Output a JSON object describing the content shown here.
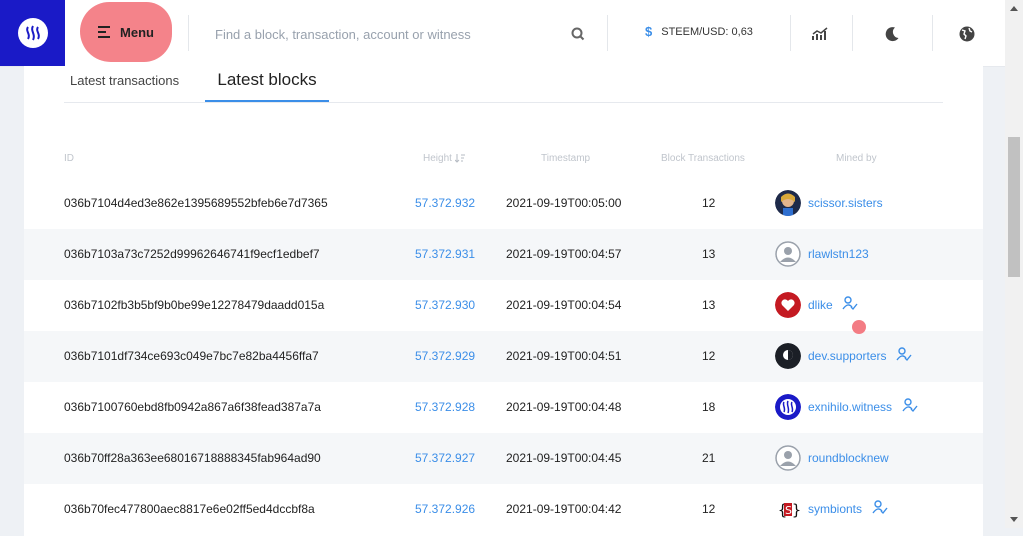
{
  "header": {
    "menu_label": "Menu",
    "search_placeholder": "Find a block, transaction, account or witness",
    "price_label": "STEEM/USD: 0,63",
    "price_symbol": "$"
  },
  "tabs": [
    {
      "label": "Latest transactions",
      "active": false
    },
    {
      "label": "Latest blocks",
      "active": true
    }
  ],
  "table": {
    "columns": [
      "ID",
      "Height",
      "Timestamp",
      "Block Transactions",
      "Mined by"
    ],
    "rows": [
      {
        "id": "036b7104d4ed3e862e1395689552bfeb6e7d7365",
        "height": "57.372.932",
        "timestamp": "2021-09-19T00:05:00",
        "txs": "12",
        "miner": "scissor.sisters",
        "verified": false,
        "avatar": "scissor"
      },
      {
        "id": "036b7103a73c7252d99962646741f9ecf1edbef7",
        "height": "57.372.931",
        "timestamp": "2021-09-19T00:04:57",
        "txs": "13",
        "miner": "rlawlstn123",
        "verified": false,
        "avatar": "default"
      },
      {
        "id": "036b7102fb3b5bf9b0be99e12278479daadd015a",
        "height": "57.372.930",
        "timestamp": "2021-09-19T00:04:54",
        "txs": "13",
        "miner": "dlike",
        "verified": true,
        "avatar": "heart"
      },
      {
        "id": "036b7101df734ce693c049e7bc7e82ba4456ffa7",
        "height": "57.372.929",
        "timestamp": "2021-09-19T00:04:51",
        "txs": "12",
        "miner": "dev.supporters",
        "verified": true,
        "avatar": "dark"
      },
      {
        "id": "036b7100760ebd8fb0942a867a6f38fead387a7a",
        "height": "57.372.928",
        "timestamp": "2021-09-19T00:04:48",
        "txs": "18",
        "miner": "exnihilo.witness",
        "verified": true,
        "avatar": "steem"
      },
      {
        "id": "036b70ff28a363ee68016718888345fab964ad90",
        "height": "57.372.927",
        "timestamp": "2021-09-19T00:04:45",
        "txs": "21",
        "miner": "roundblocknew",
        "verified": false,
        "avatar": "default"
      },
      {
        "id": "036b70fec477800aec8817e6e02ff5ed4dccbf8a",
        "height": "57.372.926",
        "timestamp": "2021-09-19T00:04:42",
        "txs": "12",
        "miner": "symbionts",
        "verified": true,
        "avatar": "symb"
      }
    ]
  },
  "colors": {
    "brand": "#1a1ac7",
    "link": "#3b8ee8",
    "highlight": "#f37c84"
  }
}
